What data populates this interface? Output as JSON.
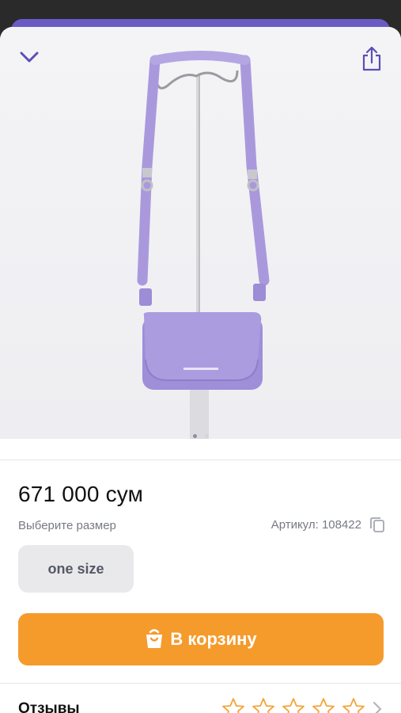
{
  "colors": {
    "accent": "#6a5bc4",
    "cart_button": "#f59b2c",
    "product": "#a896dd"
  },
  "header": {
    "collapse_icon": "chevron-down-icon",
    "share_icon": "share-icon"
  },
  "gallery": {
    "image": "purple-crossbody-bag",
    "pages": 2,
    "active_page": 1
  },
  "product": {
    "price": "671 000 сум",
    "size_prompt": "Выберите размер",
    "article": "Артикул: 108422",
    "sizes": [
      "one size"
    ]
  },
  "cart": {
    "label": "В корзину",
    "icon": "shopping-bag-icon"
  },
  "reviews": {
    "title": "Отзывы",
    "rating": 0,
    "max": 5
  }
}
